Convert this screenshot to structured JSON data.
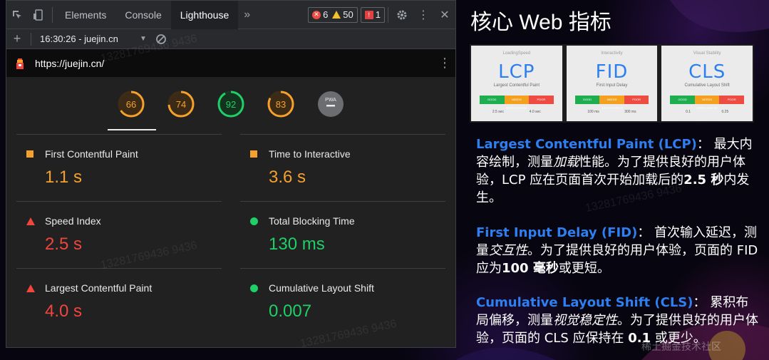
{
  "devtools": {
    "tabs": [
      "Elements",
      "Console",
      "Lighthouse"
    ],
    "more_tabs": "»",
    "badges": {
      "errors": "6",
      "warnings": "50",
      "issues": "1"
    },
    "report_selector": "16:30:26 - juejin.cn",
    "url": "https://juejin.cn/",
    "gauges": [
      {
        "score": "66",
        "color": "#f6a12b"
      },
      {
        "score": "74",
        "color": "#f6a12b"
      },
      {
        "score": "92",
        "color": "#1fcf67"
      },
      {
        "score": "83",
        "color": "#f6a12b"
      },
      {
        "label": "PWA"
      }
    ],
    "metrics": [
      {
        "name": "First Contentful Paint",
        "value": "1.1 s",
        "status": "average"
      },
      {
        "name": "Time to Interactive",
        "value": "3.6 s",
        "status": "average"
      },
      {
        "name": "Speed Index",
        "value": "2.5 s",
        "status": "fail"
      },
      {
        "name": "Total Blocking Time",
        "value": "130 ms",
        "status": "pass"
      },
      {
        "name": "Largest Contentful Paint",
        "value": "4.0 s",
        "status": "fail"
      },
      {
        "name": "Cumulative Layout Shift",
        "value": "0.007",
        "status": "pass"
      }
    ]
  },
  "slide": {
    "title": "核心 Web 指标",
    "cards": [
      {
        "top": "LoadingSpeed",
        "abbr": "LCP",
        "sub": "Largest Contentful Paint",
        "bar": [
          "GOOD",
          "NEEDS IMPROVEMENT",
          "POOR"
        ],
        "ticks": [
          "2.5 sec",
          "4.0 sec"
        ]
      },
      {
        "top": "Interactivity",
        "abbr": "FID",
        "sub": "First Input Delay",
        "bar": [
          "GOOD",
          "NEEDS IMPROVEMENT",
          "POOR"
        ],
        "ticks": [
          "100 ms",
          "300 ms"
        ]
      },
      {
        "top": "Visual Stability",
        "abbr": "CLS",
        "sub": "Cumulative Layout Shift",
        "bar": [
          "GOOD",
          "NEEDS IMPROVEMENT",
          "POOR"
        ],
        "ticks": [
          "0.1",
          "0.25"
        ]
      }
    ],
    "lcp": {
      "term": "Largest Contentful Paint (LCP)",
      "t1": "： 最大内容绘制，测量",
      "em": "加载",
      "t2": "性能。为了提供良好的用户体验，LCP 应在页面首次开始加载后的",
      "strong": "2.5 秒",
      "t3": "内发生。"
    },
    "fid": {
      "term": "First Input Delay (FID)",
      "t1": "： 首次输入延迟，测量",
      "em": "交互性",
      "t2": "。为了提供良好的用户体验，页面的 FID 应为",
      "strong": "100 毫秒",
      "t3": "或更短。"
    },
    "cls": {
      "term": "Cumulative Layout Shift (CLS)",
      "t1": "： 累积布局偏移，测量",
      "em": "视觉稳定性",
      "t2": "。为了提供良好的用户体验，页面的 CLS 应保持在 ",
      "strong": "0.1",
      "t3": " 或更少。"
    },
    "footer_brand": "稀土掘金技术社区",
    "watermark": "13281769436 9436"
  }
}
